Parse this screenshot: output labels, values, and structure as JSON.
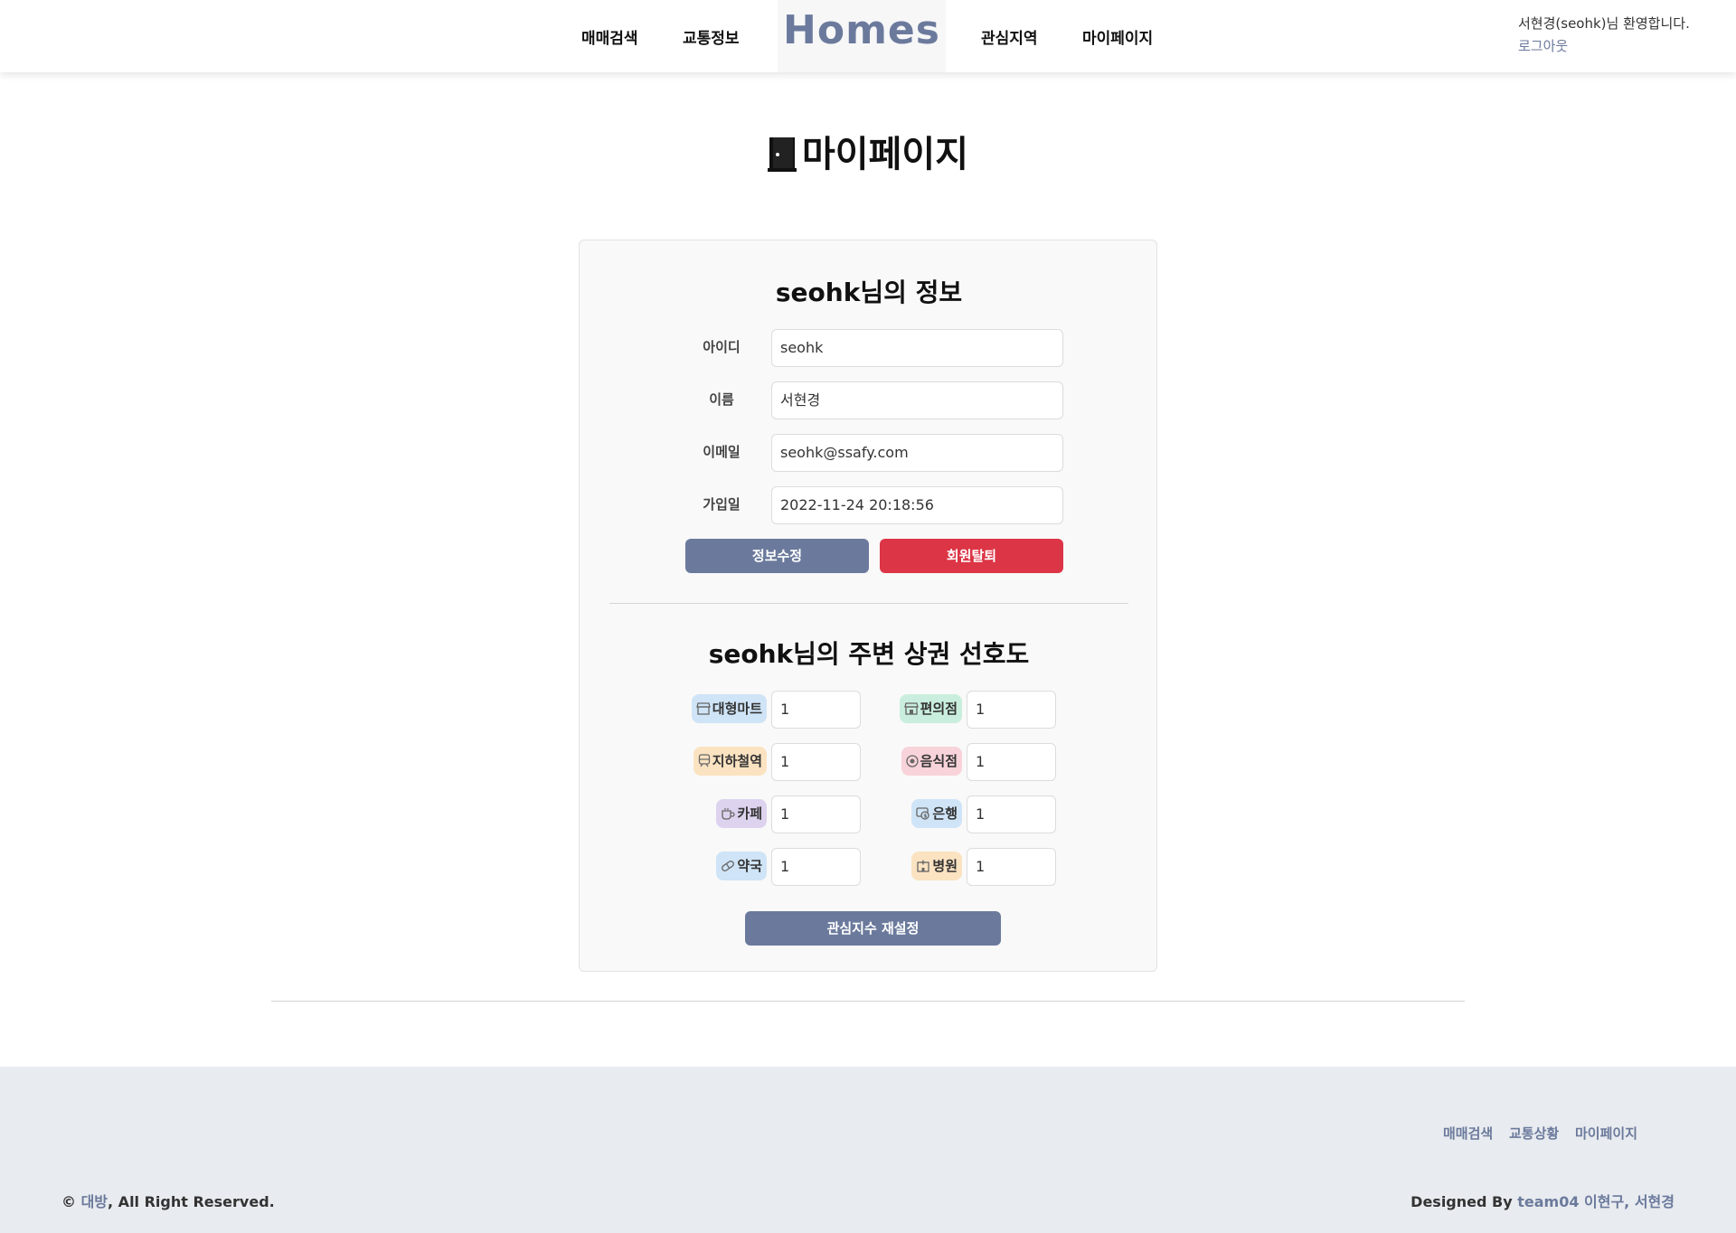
{
  "header": {
    "nav_left": [
      "매매검색",
      "교통정보"
    ],
    "logo": "Homes",
    "nav_right": [
      "관심지역",
      "마이페이지"
    ],
    "welcome": "서현경(seohk)님 환영합니다.",
    "logout": "로그아웃"
  },
  "page_title": "마이페이지",
  "info": {
    "heading": "seohk님의 정보",
    "fields": [
      {
        "label": "아이디",
        "value": "seohk"
      },
      {
        "label": "이름",
        "value": "서현경"
      },
      {
        "label": "이메일",
        "value": "seohk@ssafy.com"
      },
      {
        "label": "가입일",
        "value": "2022-11-24 20:18:56"
      }
    ],
    "edit_button": "정보수정",
    "delete_button": "회원탈퇴"
  },
  "preferences": {
    "heading": "seohk님의 주변 상권 선호도",
    "items": [
      {
        "label": "대형마트",
        "value": "1",
        "icon": "store-icon",
        "color": "#cfe4f7"
      },
      {
        "label": "편의점",
        "value": "1",
        "icon": "shop-icon",
        "color": "#c9eedd"
      },
      {
        "label": "지하철역",
        "value": "1",
        "icon": "train-icon",
        "color": "#fbe3c2"
      },
      {
        "label": "음식점",
        "value": "1",
        "icon": "restaurant-icon",
        "color": "#f8d3da"
      },
      {
        "label": "카페",
        "value": "1",
        "icon": "cup-icon",
        "color": "#ddd3ef"
      },
      {
        "label": "은행",
        "value": "1",
        "icon": "bank-icon",
        "color": "#cfe4f7"
      },
      {
        "label": "약국",
        "value": "1",
        "icon": "pill-icon",
        "color": "#cfe4f7"
      },
      {
        "label": "병원",
        "value": "1",
        "icon": "hospital-icon",
        "color": "#fbe3c2"
      }
    ],
    "reset_button": "관심지수 재설정"
  },
  "footer": {
    "links": [
      "매매검색",
      "교통상황",
      "마이페이지"
    ],
    "copyright_symbol": "©",
    "copyright_brand": "대방",
    "copyright_rest": ", All Right Reserved.",
    "designed_prefix": "Designed By",
    "designed_team": "team04 이현구, 서현경"
  },
  "colors": {
    "accent": "#6b7a9c",
    "danger": "#dc3545"
  }
}
